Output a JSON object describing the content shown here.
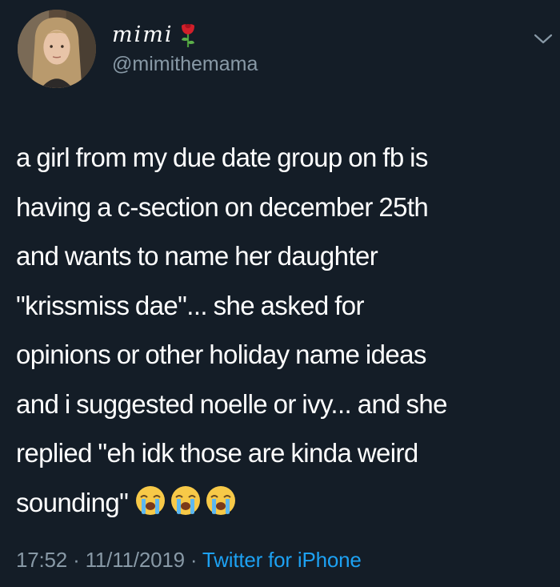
{
  "tweet": {
    "display_name": "mimi",
    "name_emoji": "rose-icon",
    "handle": "@mimithemama",
    "text_lines": [
      "a girl from my due date group on fb is",
      "having a c-section on december 25th",
      "and wants to name her daughter",
      "\"krissmiss dae\"... she asked for",
      "opinions or other holiday name ideas",
      "and i suggested noelle or ivy... and she",
      "replied \"eh idk those are kinda weird",
      "sounding\""
    ],
    "trailing_emojis": [
      "loudly-crying-face-icon",
      "loudly-crying-face-icon",
      "loudly-crying-face-icon"
    ],
    "time": "17:52",
    "separator1": " · ",
    "date": "11/11/2019",
    "separator2": " · ",
    "source": "Twitter for iPhone"
  },
  "colors": {
    "background": "#141d27",
    "text": "#ffffff",
    "secondary": "#8899a6",
    "link": "#1da1f2"
  }
}
